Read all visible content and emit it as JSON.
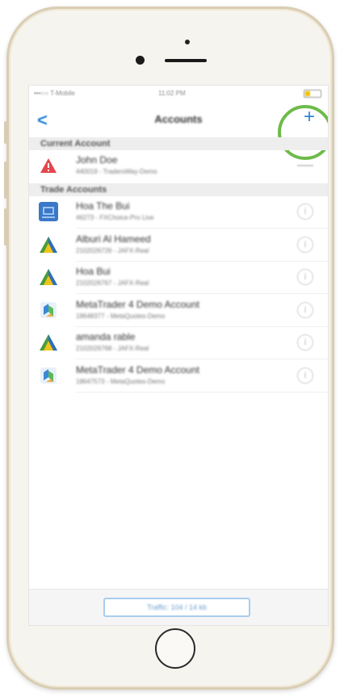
{
  "status_bar": {
    "carrier": "•••○○ T-Mobile",
    "time": "11:02 PM",
    "battery_level": 0.35
  },
  "nav": {
    "back_icon": "chevron-left-icon",
    "title": "Accounts",
    "add_label": "+",
    "accent": "#2f86d6",
    "highlight_color": "#6dbb4a"
  },
  "sections": {
    "current": "Current Account",
    "trade": "Trade Accounts"
  },
  "current_account": {
    "name": "John Doe",
    "detail": "440019 - TradersWay-Demo",
    "icon": "warning-red-icon"
  },
  "trade_accounts": [
    {
      "name": "Hoa The Bui",
      "detail": "46273 - FXChoice-Pro Live",
      "icon": "blue-broker-icon"
    },
    {
      "name": "Alburi Al Hameed",
      "detail": "2102026726 - JAFX-Real",
      "icon": "jafx-triangle-icon"
    },
    {
      "name": "Hoa Bui",
      "detail": "2102026767 - JAFX-Real",
      "icon": "jafx-triangle-icon"
    },
    {
      "name": "MetaTrader 4 Demo Account",
      "detail": "18648377 - MetaQuotes-Demo",
      "icon": "metaquotes-icon"
    },
    {
      "name": "amanda rable",
      "detail": "2102026768 - JAFX-Real",
      "icon": "jafx-triangle-icon"
    },
    {
      "name": "MetaTrader 4 Demo Account",
      "detail": "18647573 - MetaQuotes-Demo",
      "icon": "metaquotes-icon"
    }
  ],
  "info_glyph": "i",
  "footer": {
    "button_label": "Traffic: 104 / 14 kb"
  }
}
